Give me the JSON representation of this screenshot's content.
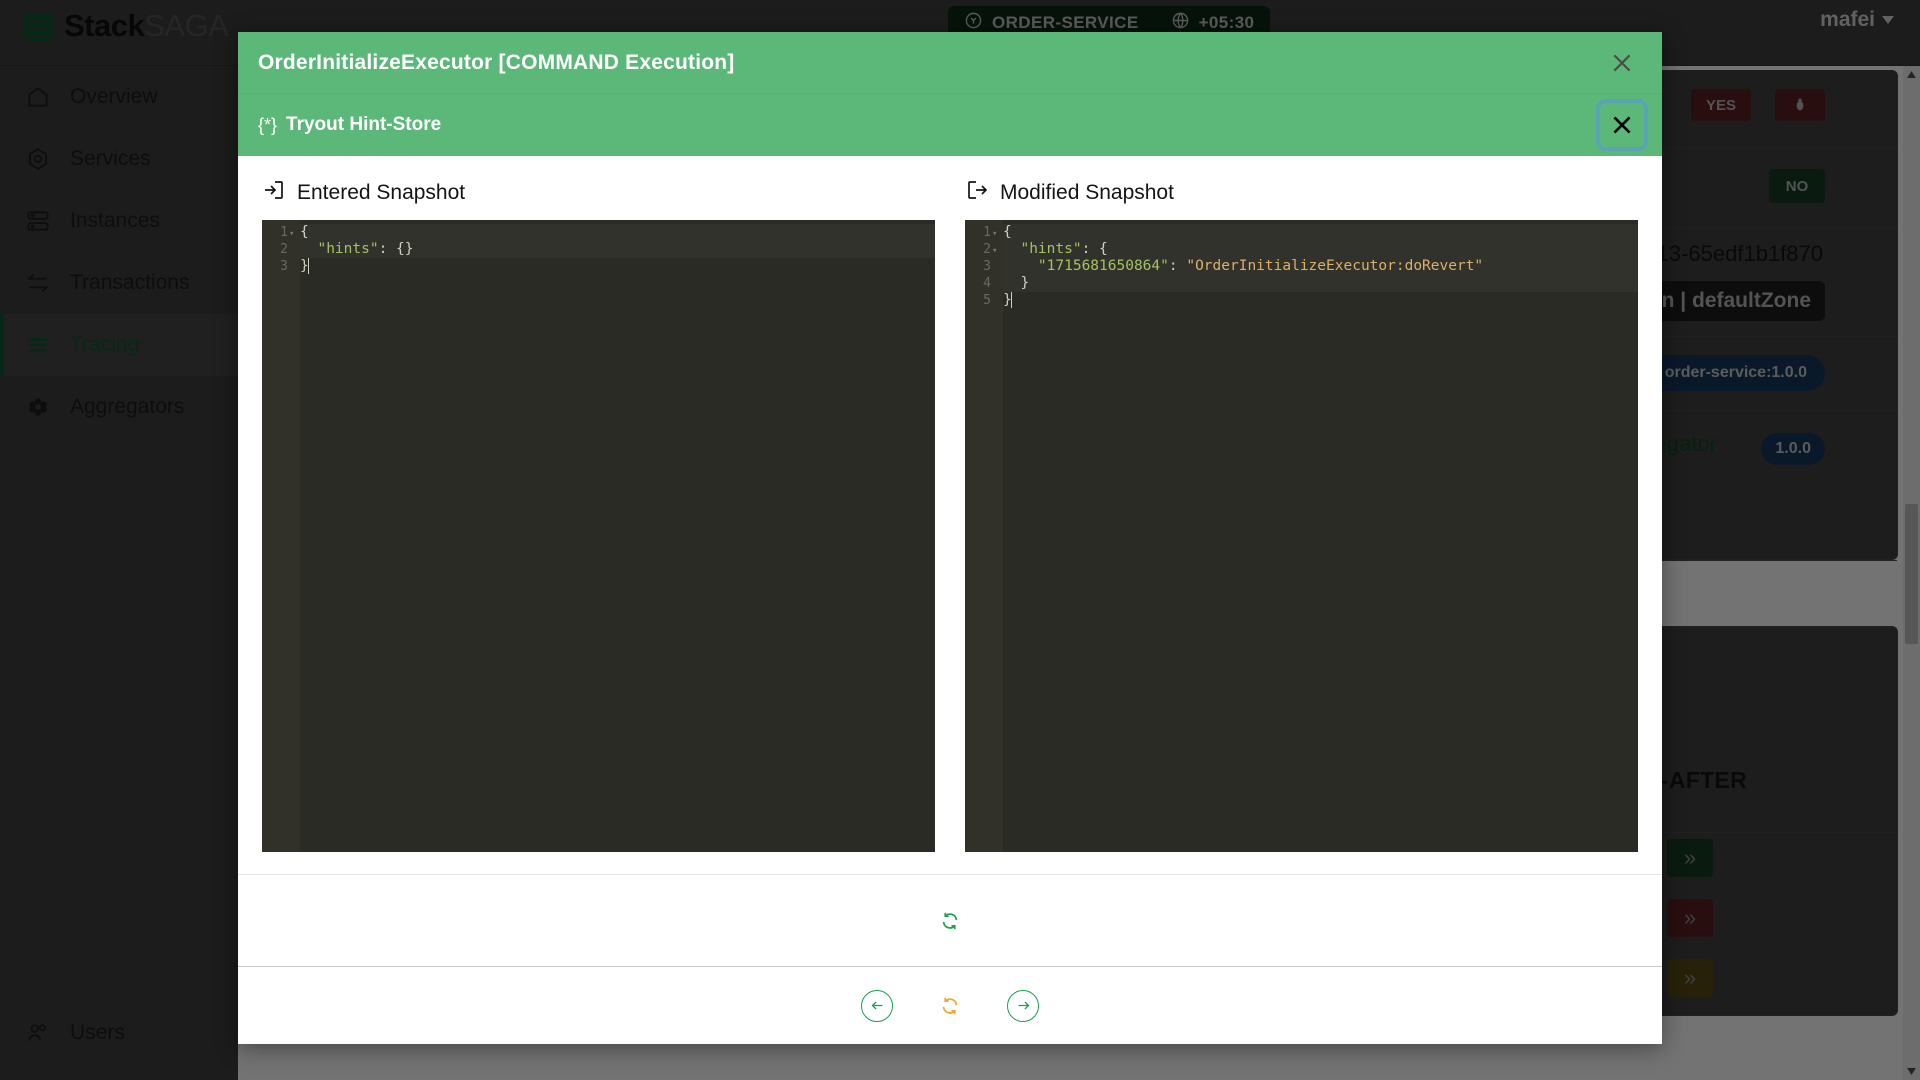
{
  "app": {
    "brand_primary": "Stack",
    "brand_secondary": "SAGA",
    "service_badge": "ORDER-SERVICE",
    "timezone_badge": "+05:30",
    "user": "mafei"
  },
  "sidebar": {
    "items": [
      {
        "label": "Overview",
        "icon": "home-icon",
        "active": false
      },
      {
        "label": "Services",
        "icon": "hexagon-icon",
        "active": false
      },
      {
        "label": "Instances",
        "icon": "server-icon",
        "active": false
      },
      {
        "label": "Transactions",
        "icon": "exchange-icon",
        "active": false
      },
      {
        "label": "Tracing",
        "icon": "lines-icon",
        "active": true
      },
      {
        "label": "Aggregators",
        "icon": "flower-icon",
        "active": false
      }
    ],
    "bottom_item": {
      "label": "Users",
      "icon": "users-icon"
    }
  },
  "background": {
    "badge_yes": "YES",
    "badge_bug": "bug-icon",
    "badge_no": "NO",
    "instance_id_fragment": "13-65edf1b1f870",
    "zone_label": "n | defaultZone",
    "service_version": "order-service:1.0.0",
    "aggregator_label": "Aggregator",
    "aggregator_version": "1.0.0",
    "sub_after_label": "SUB-AFTER",
    "chevron_rows": [
      "chevron-right-green",
      "chevron-right-red",
      "chevron-right-olive"
    ]
  },
  "modal": {
    "title": "OrderInitializeExecutor [COMMAND Execution]",
    "subtitle": "Tryout Hint-Store",
    "subtitle_braces": "{*}",
    "close_primary_label": "close-icon",
    "close_secondary_label": "close-icon",
    "header_color": "#5cb878",
    "panes": [
      {
        "title": "Entered Snapshot",
        "icon": "arrow-into-box-icon",
        "lines": [
          {
            "num": "1",
            "fold": true,
            "highlight": true,
            "segments": [
              {
                "cls": "p",
                "text": "{"
              }
            ]
          },
          {
            "num": "2",
            "fold": false,
            "highlight": true,
            "segments": [
              {
                "cls": "p",
                "text": "  "
              },
              {
                "cls": "k",
                "text": "\"hints\""
              },
              {
                "cls": "p",
                "text": ": {}"
              }
            ]
          },
          {
            "num": "3",
            "fold": false,
            "highlight": false,
            "segments": [
              {
                "cls": "p",
                "text": "}"
              }
            ]
          }
        ]
      },
      {
        "title": "Modified Snapshot",
        "icon": "arrow-out-of-box-icon",
        "lines": [
          {
            "num": "1",
            "fold": true,
            "highlight": true,
            "segments": [
              {
                "cls": "p",
                "text": "{"
              }
            ]
          },
          {
            "num": "2",
            "fold": true,
            "highlight": true,
            "segments": [
              {
                "cls": "p",
                "text": "  "
              },
              {
                "cls": "k",
                "text": "\"hints\""
              },
              {
                "cls": "p",
                "text": ": {"
              }
            ]
          },
          {
            "num": "3",
            "fold": false,
            "highlight": true,
            "segments": [
              {
                "cls": "p",
                "text": "    "
              },
              {
                "cls": "k",
                "text": "\"1715681650864\""
              },
              {
                "cls": "p",
                "text": ": "
              },
              {
                "cls": "v",
                "text": "\"OrderInitializeExecutor:doRevert\""
              }
            ]
          },
          {
            "num": "4",
            "fold": false,
            "highlight": true,
            "segments": [
              {
                "cls": "p",
                "text": "  }"
              }
            ]
          },
          {
            "num": "5",
            "fold": false,
            "highlight": false,
            "segments": [
              {
                "cls": "p",
                "text": "}"
              }
            ]
          }
        ]
      }
    ],
    "middle_action": {
      "name": "refresh-icon",
      "color": "#19a050"
    },
    "footer_actions": [
      {
        "name": "previous-button",
        "icon": "arrow-left-icon",
        "color": "#19a050"
      },
      {
        "name": "reload-button",
        "icon": "refresh-icon",
        "color": "#f0a52a"
      },
      {
        "name": "next-button",
        "icon": "arrow-right-icon",
        "color": "#19a050"
      }
    ]
  }
}
